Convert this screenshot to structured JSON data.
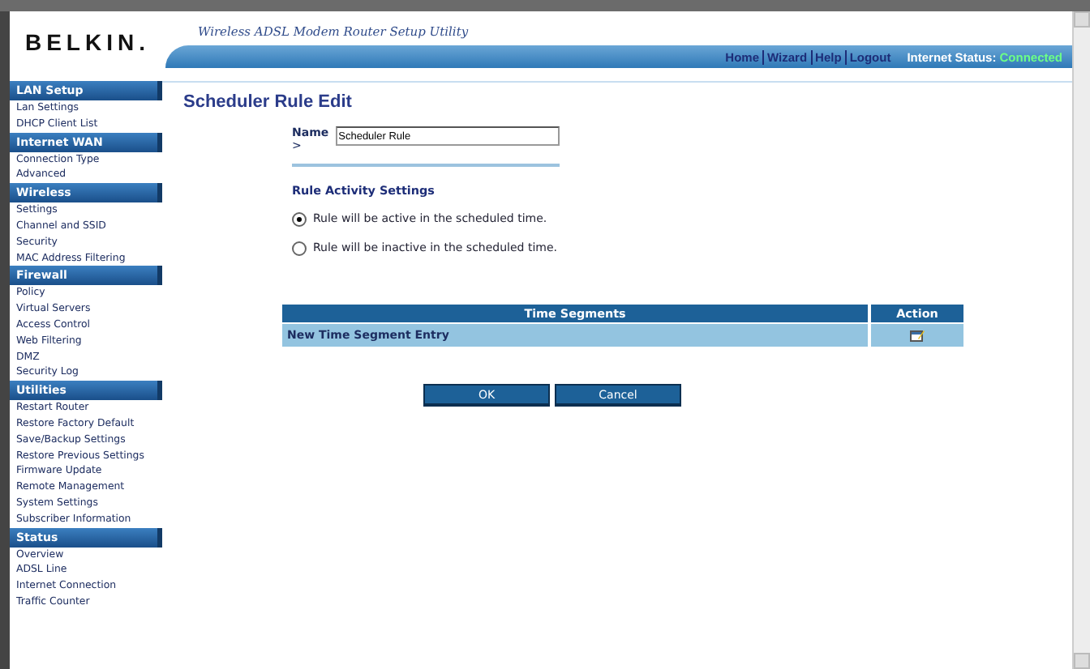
{
  "header": {
    "logo": "BELKIN",
    "logo_dot": ".",
    "tagline": "Wireless ADSL Modem Router Setup Utility",
    "links": [
      "Home",
      "Wizard",
      "Help",
      "Logout"
    ],
    "status_label": "Internet Status:",
    "status_value": "Connected"
  },
  "sidebar": [
    {
      "title": "LAN Setup",
      "items": [
        "Lan Settings",
        "DHCP Client List"
      ]
    },
    {
      "title": "Internet WAN",
      "items": [
        "Connection Type",
        "Advanced"
      ]
    },
    {
      "title": "Wireless",
      "items": [
        "Settings",
        "Channel and SSID",
        "Security",
        "MAC Address Filtering"
      ]
    },
    {
      "title": "Firewall",
      "items": [
        "Policy",
        "Virtual Servers",
        "Access Control",
        "Web Filtering",
        "DMZ",
        "Security Log"
      ]
    },
    {
      "title": "Utilities",
      "items": [
        "Restart Router",
        "Restore Factory Default",
        "Save/Backup Settings",
        "Restore Previous Settings",
        "Firmware Update",
        "Remote Management",
        "System Settings",
        "Subscriber Information"
      ]
    },
    {
      "title": "Status",
      "items": [
        "Overview",
        "ADSL Line",
        "Internet Connection",
        "Traffic Counter"
      ]
    }
  ],
  "page_title": "Scheduler Rule Edit",
  "name_field": {
    "label": "Name",
    "arrow": ">",
    "value": "Scheduler Rule"
  },
  "rule_activity": {
    "title": "Rule Activity Settings",
    "options": [
      {
        "label": "Rule will be active in the scheduled time.",
        "selected": true
      },
      {
        "label": "Rule will be inactive in the scheduled time.",
        "selected": false
      }
    ]
  },
  "table": {
    "columns": [
      "Time Segments",
      "Action"
    ],
    "rows": [
      {
        "label": "New Time Segment Entry"
      }
    ]
  },
  "buttons": [
    "OK",
    "Cancel"
  ]
}
